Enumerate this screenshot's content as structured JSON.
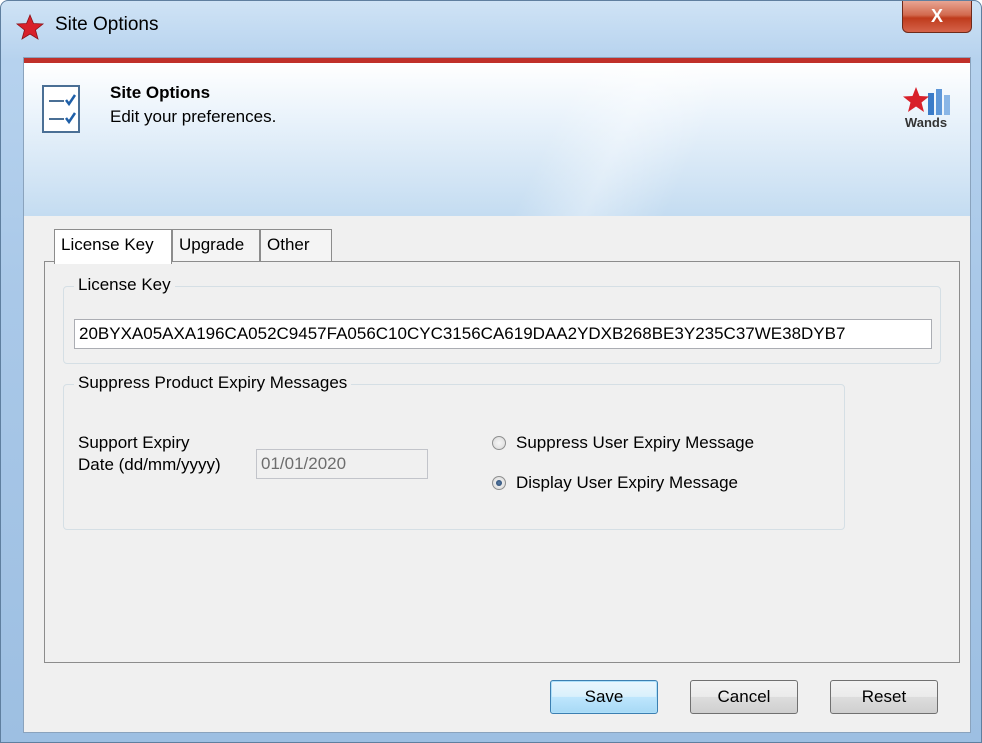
{
  "window": {
    "title": "Site Options",
    "close_label": "X"
  },
  "header": {
    "title": "Site Options",
    "subtitle": "Edit your preferences.",
    "logo_text": "Wands"
  },
  "tabs": [
    {
      "label": "License Key",
      "active": true
    },
    {
      "label": "Upgrade",
      "active": false
    },
    {
      "label": "Other",
      "active": false
    }
  ],
  "license": {
    "group_label": "License Key",
    "value": "20BYXA05AXA196CA052C9457FA056C10CYC3156CA619DAA2YDXB268BE3Y235C37WE38DYB7"
  },
  "expiry": {
    "group_label": "Suppress Product Expiry Messages",
    "support_label_line1": "Support Expiry",
    "support_label_line2": "Date (dd/mm/yyyy)",
    "date_value": "01/01/2020",
    "radio_suppress": "Suppress User Expiry Message",
    "radio_display": "Display User Expiry Message",
    "selected": "display"
  },
  "buttons": {
    "save": "Save",
    "cancel": "Cancel",
    "reset": "Reset"
  },
  "colors": {
    "accent_red": "#c0302a",
    "frame_blue": "#a9c8e8"
  },
  "icons": {
    "title_icon": "red-star-icon",
    "header_icon": "checklist-icon",
    "logo_icon": "wands-logo-icon"
  }
}
